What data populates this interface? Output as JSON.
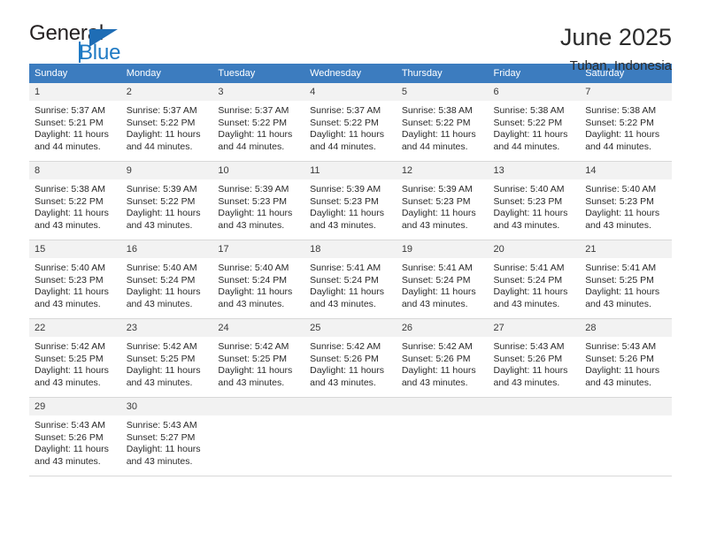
{
  "brand": {
    "name_part1": "General",
    "name_part2": "Blue",
    "triangle_icon": "triangle-icon",
    "accent_color": "#1f7ac4"
  },
  "header": {
    "title": "June 2025",
    "subtitle": "Tuban, Indonesia"
  },
  "calendar": {
    "header_bg": "#3c7cbf",
    "daynum_bg": "#f2f2f2",
    "weekdays": [
      "Sunday",
      "Monday",
      "Tuesday",
      "Wednesday",
      "Thursday",
      "Friday",
      "Saturday"
    ],
    "weeks": [
      [
        {
          "day": "1",
          "sunrise": "Sunrise: 5:37 AM",
          "sunset": "Sunset: 5:21 PM",
          "daylight": "Daylight: 11 hours and 44 minutes."
        },
        {
          "day": "2",
          "sunrise": "Sunrise: 5:37 AM",
          "sunset": "Sunset: 5:22 PM",
          "daylight": "Daylight: 11 hours and 44 minutes."
        },
        {
          "day": "3",
          "sunrise": "Sunrise: 5:37 AM",
          "sunset": "Sunset: 5:22 PM",
          "daylight": "Daylight: 11 hours and 44 minutes."
        },
        {
          "day": "4",
          "sunrise": "Sunrise: 5:37 AM",
          "sunset": "Sunset: 5:22 PM",
          "daylight": "Daylight: 11 hours and 44 minutes."
        },
        {
          "day": "5",
          "sunrise": "Sunrise: 5:38 AM",
          "sunset": "Sunset: 5:22 PM",
          "daylight": "Daylight: 11 hours and 44 minutes."
        },
        {
          "day": "6",
          "sunrise": "Sunrise: 5:38 AM",
          "sunset": "Sunset: 5:22 PM",
          "daylight": "Daylight: 11 hours and 44 minutes."
        },
        {
          "day": "7",
          "sunrise": "Sunrise: 5:38 AM",
          "sunset": "Sunset: 5:22 PM",
          "daylight": "Daylight: 11 hours and 44 minutes."
        }
      ],
      [
        {
          "day": "8",
          "sunrise": "Sunrise: 5:38 AM",
          "sunset": "Sunset: 5:22 PM",
          "daylight": "Daylight: 11 hours and 43 minutes."
        },
        {
          "day": "9",
          "sunrise": "Sunrise: 5:39 AM",
          "sunset": "Sunset: 5:22 PM",
          "daylight": "Daylight: 11 hours and 43 minutes."
        },
        {
          "day": "10",
          "sunrise": "Sunrise: 5:39 AM",
          "sunset": "Sunset: 5:23 PM",
          "daylight": "Daylight: 11 hours and 43 minutes."
        },
        {
          "day": "11",
          "sunrise": "Sunrise: 5:39 AM",
          "sunset": "Sunset: 5:23 PM",
          "daylight": "Daylight: 11 hours and 43 minutes."
        },
        {
          "day": "12",
          "sunrise": "Sunrise: 5:39 AM",
          "sunset": "Sunset: 5:23 PM",
          "daylight": "Daylight: 11 hours and 43 minutes."
        },
        {
          "day": "13",
          "sunrise": "Sunrise: 5:40 AM",
          "sunset": "Sunset: 5:23 PM",
          "daylight": "Daylight: 11 hours and 43 minutes."
        },
        {
          "day": "14",
          "sunrise": "Sunrise: 5:40 AM",
          "sunset": "Sunset: 5:23 PM",
          "daylight": "Daylight: 11 hours and 43 minutes."
        }
      ],
      [
        {
          "day": "15",
          "sunrise": "Sunrise: 5:40 AM",
          "sunset": "Sunset: 5:23 PM",
          "daylight": "Daylight: 11 hours and 43 minutes."
        },
        {
          "day": "16",
          "sunrise": "Sunrise: 5:40 AM",
          "sunset": "Sunset: 5:24 PM",
          "daylight": "Daylight: 11 hours and 43 minutes."
        },
        {
          "day": "17",
          "sunrise": "Sunrise: 5:40 AM",
          "sunset": "Sunset: 5:24 PM",
          "daylight": "Daylight: 11 hours and 43 minutes."
        },
        {
          "day": "18",
          "sunrise": "Sunrise: 5:41 AM",
          "sunset": "Sunset: 5:24 PM",
          "daylight": "Daylight: 11 hours and 43 minutes."
        },
        {
          "day": "19",
          "sunrise": "Sunrise: 5:41 AM",
          "sunset": "Sunset: 5:24 PM",
          "daylight": "Daylight: 11 hours and 43 minutes."
        },
        {
          "day": "20",
          "sunrise": "Sunrise: 5:41 AM",
          "sunset": "Sunset: 5:24 PM",
          "daylight": "Daylight: 11 hours and 43 minutes."
        },
        {
          "day": "21",
          "sunrise": "Sunrise: 5:41 AM",
          "sunset": "Sunset: 5:25 PM",
          "daylight": "Daylight: 11 hours and 43 minutes."
        }
      ],
      [
        {
          "day": "22",
          "sunrise": "Sunrise: 5:42 AM",
          "sunset": "Sunset: 5:25 PM",
          "daylight": "Daylight: 11 hours and 43 minutes."
        },
        {
          "day": "23",
          "sunrise": "Sunrise: 5:42 AM",
          "sunset": "Sunset: 5:25 PM",
          "daylight": "Daylight: 11 hours and 43 minutes."
        },
        {
          "day": "24",
          "sunrise": "Sunrise: 5:42 AM",
          "sunset": "Sunset: 5:25 PM",
          "daylight": "Daylight: 11 hours and 43 minutes."
        },
        {
          "day": "25",
          "sunrise": "Sunrise: 5:42 AM",
          "sunset": "Sunset: 5:26 PM",
          "daylight": "Daylight: 11 hours and 43 minutes."
        },
        {
          "day": "26",
          "sunrise": "Sunrise: 5:42 AM",
          "sunset": "Sunset: 5:26 PM",
          "daylight": "Daylight: 11 hours and 43 minutes."
        },
        {
          "day": "27",
          "sunrise": "Sunrise: 5:43 AM",
          "sunset": "Sunset: 5:26 PM",
          "daylight": "Daylight: 11 hours and 43 minutes."
        },
        {
          "day": "28",
          "sunrise": "Sunrise: 5:43 AM",
          "sunset": "Sunset: 5:26 PM",
          "daylight": "Daylight: 11 hours and 43 minutes."
        }
      ],
      [
        {
          "day": "29",
          "sunrise": "Sunrise: 5:43 AM",
          "sunset": "Sunset: 5:26 PM",
          "daylight": "Daylight: 11 hours and 43 minutes."
        },
        {
          "day": "30",
          "sunrise": "Sunrise: 5:43 AM",
          "sunset": "Sunset: 5:27 PM",
          "daylight": "Daylight: 11 hours and 43 minutes."
        },
        {
          "day": "",
          "sunrise": "",
          "sunset": "",
          "daylight": ""
        },
        {
          "day": "",
          "sunrise": "",
          "sunset": "",
          "daylight": ""
        },
        {
          "day": "",
          "sunrise": "",
          "sunset": "",
          "daylight": ""
        },
        {
          "day": "",
          "sunrise": "",
          "sunset": "",
          "daylight": ""
        },
        {
          "day": "",
          "sunrise": "",
          "sunset": "",
          "daylight": ""
        }
      ]
    ]
  }
}
